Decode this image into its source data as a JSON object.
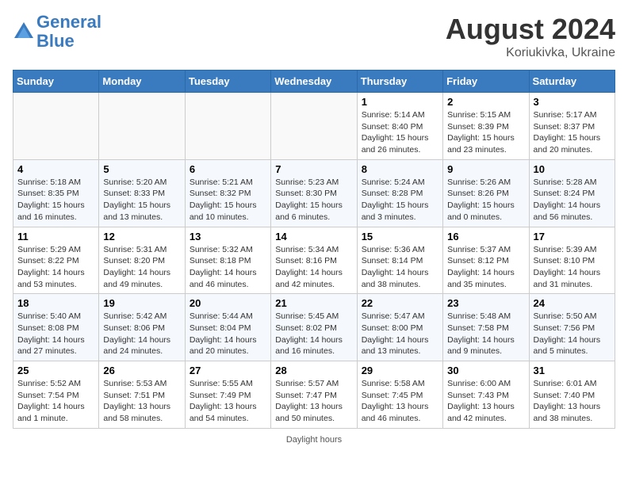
{
  "header": {
    "logo_line1": "General",
    "logo_line2": "Blue",
    "month_year": "August 2024",
    "location": "Koriukivka, Ukraine"
  },
  "weekdays": [
    "Sunday",
    "Monday",
    "Tuesday",
    "Wednesday",
    "Thursday",
    "Friday",
    "Saturday"
  ],
  "weeks": [
    [
      {
        "day": "",
        "empty": true
      },
      {
        "day": "",
        "empty": true
      },
      {
        "day": "",
        "empty": true
      },
      {
        "day": "",
        "empty": true
      },
      {
        "day": "1",
        "sunrise": "5:14 AM",
        "sunset": "8:40 PM",
        "daylight": "15 hours and 26 minutes."
      },
      {
        "day": "2",
        "sunrise": "5:15 AM",
        "sunset": "8:39 PM",
        "daylight": "15 hours and 23 minutes."
      },
      {
        "day": "3",
        "sunrise": "5:17 AM",
        "sunset": "8:37 PM",
        "daylight": "15 hours and 20 minutes."
      }
    ],
    [
      {
        "day": "4",
        "sunrise": "5:18 AM",
        "sunset": "8:35 PM",
        "daylight": "15 hours and 16 minutes."
      },
      {
        "day": "5",
        "sunrise": "5:20 AM",
        "sunset": "8:33 PM",
        "daylight": "15 hours and 13 minutes."
      },
      {
        "day": "6",
        "sunrise": "5:21 AM",
        "sunset": "8:32 PM",
        "daylight": "15 hours and 10 minutes."
      },
      {
        "day": "7",
        "sunrise": "5:23 AM",
        "sunset": "8:30 PM",
        "daylight": "15 hours and 6 minutes."
      },
      {
        "day": "8",
        "sunrise": "5:24 AM",
        "sunset": "8:28 PM",
        "daylight": "15 hours and 3 minutes."
      },
      {
        "day": "9",
        "sunrise": "5:26 AM",
        "sunset": "8:26 PM",
        "daylight": "15 hours and 0 minutes."
      },
      {
        "day": "10",
        "sunrise": "5:28 AM",
        "sunset": "8:24 PM",
        "daylight": "14 hours and 56 minutes."
      }
    ],
    [
      {
        "day": "11",
        "sunrise": "5:29 AM",
        "sunset": "8:22 PM",
        "daylight": "14 hours and 53 minutes."
      },
      {
        "day": "12",
        "sunrise": "5:31 AM",
        "sunset": "8:20 PM",
        "daylight": "14 hours and 49 minutes."
      },
      {
        "day": "13",
        "sunrise": "5:32 AM",
        "sunset": "8:18 PM",
        "daylight": "14 hours and 46 minutes."
      },
      {
        "day": "14",
        "sunrise": "5:34 AM",
        "sunset": "8:16 PM",
        "daylight": "14 hours and 42 minutes."
      },
      {
        "day": "15",
        "sunrise": "5:36 AM",
        "sunset": "8:14 PM",
        "daylight": "14 hours and 38 minutes."
      },
      {
        "day": "16",
        "sunrise": "5:37 AM",
        "sunset": "8:12 PM",
        "daylight": "14 hours and 35 minutes."
      },
      {
        "day": "17",
        "sunrise": "5:39 AM",
        "sunset": "8:10 PM",
        "daylight": "14 hours and 31 minutes."
      }
    ],
    [
      {
        "day": "18",
        "sunrise": "5:40 AM",
        "sunset": "8:08 PM",
        "daylight": "14 hours and 27 minutes."
      },
      {
        "day": "19",
        "sunrise": "5:42 AM",
        "sunset": "8:06 PM",
        "daylight": "14 hours and 24 minutes."
      },
      {
        "day": "20",
        "sunrise": "5:44 AM",
        "sunset": "8:04 PM",
        "daylight": "14 hours and 20 minutes."
      },
      {
        "day": "21",
        "sunrise": "5:45 AM",
        "sunset": "8:02 PM",
        "daylight": "14 hours and 16 minutes."
      },
      {
        "day": "22",
        "sunrise": "5:47 AM",
        "sunset": "8:00 PM",
        "daylight": "14 hours and 13 minutes."
      },
      {
        "day": "23",
        "sunrise": "5:48 AM",
        "sunset": "7:58 PM",
        "daylight": "14 hours and 9 minutes."
      },
      {
        "day": "24",
        "sunrise": "5:50 AM",
        "sunset": "7:56 PM",
        "daylight": "14 hours and 5 minutes."
      }
    ],
    [
      {
        "day": "25",
        "sunrise": "5:52 AM",
        "sunset": "7:54 PM",
        "daylight": "14 hours and 1 minute."
      },
      {
        "day": "26",
        "sunrise": "5:53 AM",
        "sunset": "7:51 PM",
        "daylight": "13 hours and 58 minutes."
      },
      {
        "day": "27",
        "sunrise": "5:55 AM",
        "sunset": "7:49 PM",
        "daylight": "13 hours and 54 minutes."
      },
      {
        "day": "28",
        "sunrise": "5:57 AM",
        "sunset": "7:47 PM",
        "daylight": "13 hours and 50 minutes."
      },
      {
        "day": "29",
        "sunrise": "5:58 AM",
        "sunset": "7:45 PM",
        "daylight": "13 hours and 46 minutes."
      },
      {
        "day": "30",
        "sunrise": "6:00 AM",
        "sunset": "7:43 PM",
        "daylight": "13 hours and 42 minutes."
      },
      {
        "day": "31",
        "sunrise": "6:01 AM",
        "sunset": "7:40 PM",
        "daylight": "13 hours and 38 minutes."
      }
    ]
  ],
  "footer": {
    "daylight_label": "Daylight hours"
  }
}
